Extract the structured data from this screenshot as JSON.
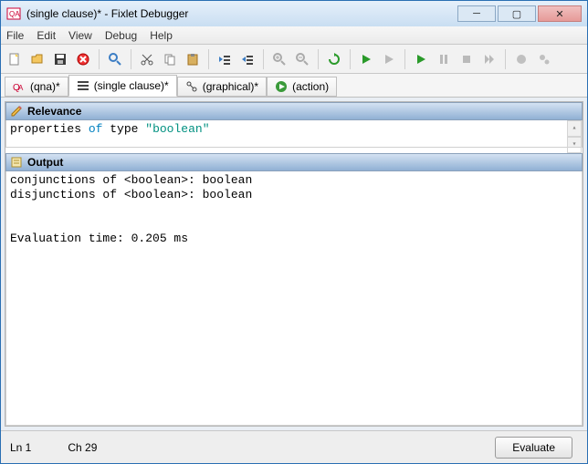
{
  "window": {
    "title": "(single clause)* - Fixlet Debugger"
  },
  "menu": {
    "file": "File",
    "edit": "Edit",
    "view": "View",
    "debug": "Debug",
    "help": "Help"
  },
  "tabs": {
    "qna": {
      "label": "(qna)*"
    },
    "single": {
      "label": "(single clause)*"
    },
    "graph": {
      "label": "(graphical)*"
    },
    "action": {
      "label": "(action)"
    }
  },
  "sections": {
    "relevance_title": "Relevance",
    "output_title": "Output"
  },
  "relevance": {
    "word1": "properties",
    "word_of": "of",
    "word3": "type",
    "str": "\"boolean\""
  },
  "output": {
    "text": "conjunctions of <boolean>: boolean\ndisjunctions of <boolean>: boolean\n\n\nEvaluation time: 0.205 ms"
  },
  "status": {
    "line": "Ln 1",
    "col": "Ch 29"
  },
  "buttons": {
    "evaluate": "Evaluate"
  }
}
